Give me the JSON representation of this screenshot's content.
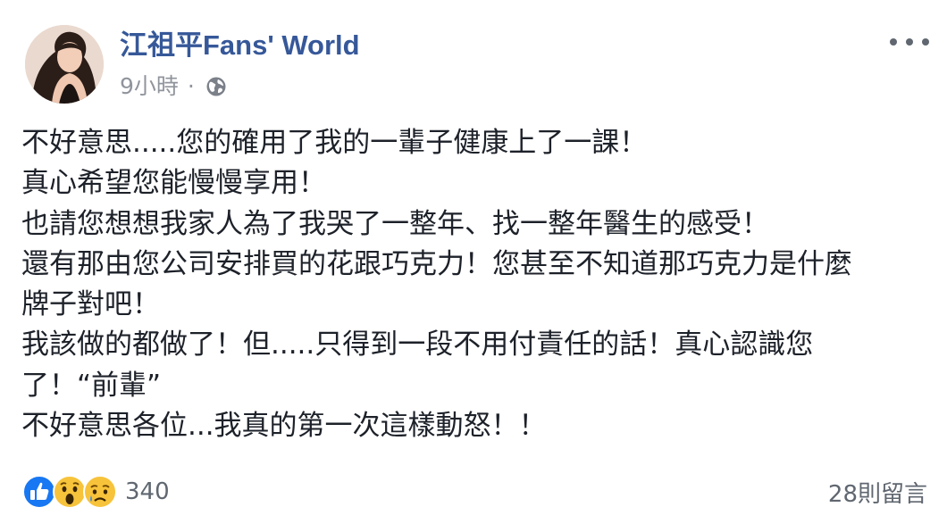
{
  "post": {
    "page_name": "江祖平Fans' World",
    "timestamp": "9小時",
    "separator": "·",
    "privacy_icon": "globe-icon",
    "menu_icon": "more-options-icon",
    "lines": [
      "不好意思.....您的確用了我的一輩子健康上了一課！",
      "真心希望您能慢慢享用！",
      "也請您想想我家人為了我哭了一整年、找一整年醫生的感受！",
      "還有那由您公司安排買的花跟巧克力！您甚至不知道那巧克力是什麼",
      "牌子對吧！",
      "我該做的都做了！但.....只得到一段不用付責任的話！真心認識您",
      "了！“前輩”",
      "不好意思各位...我真的第一次這樣動怒！！"
    ],
    "reactions": {
      "icons": [
        "like-icon",
        "wow-icon",
        "sad-icon"
      ],
      "count": "340"
    },
    "comments_label": "28則留言"
  },
  "colors": {
    "page_name": "#365899",
    "meta_text": "#90949c",
    "body_text": "#1d2129",
    "like_blue": "#1877f2",
    "reaction_yellow": "#f7c33b"
  }
}
